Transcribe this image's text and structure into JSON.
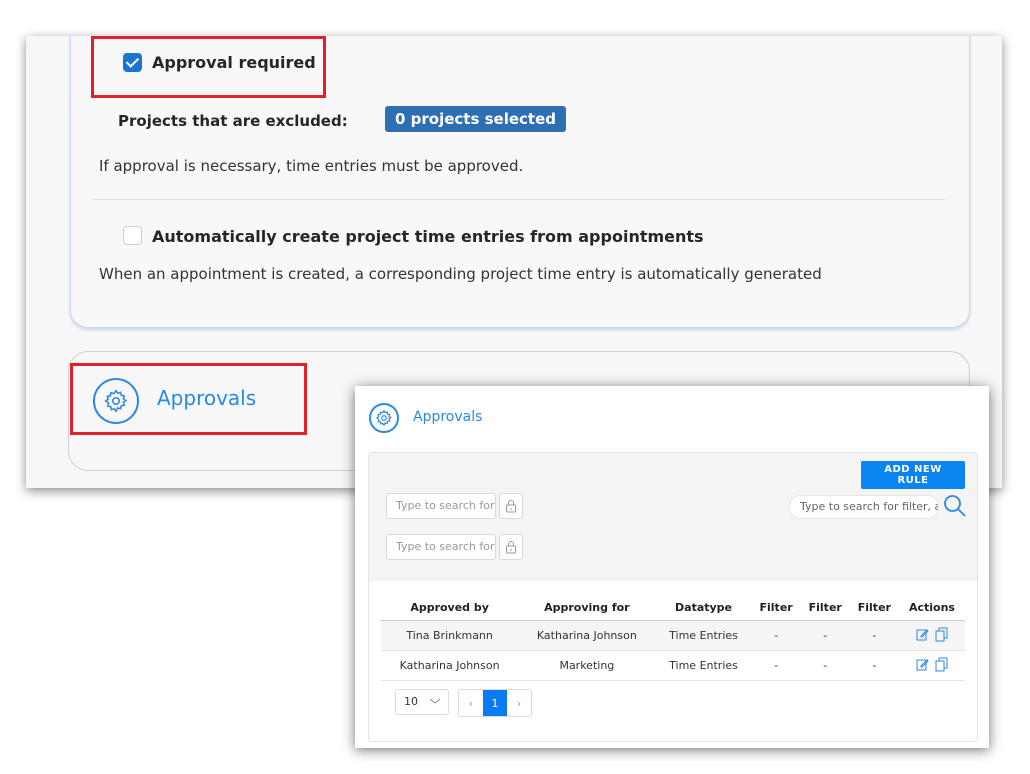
{
  "settings": {
    "approval_required_label": "Approval required",
    "approval_required_checked": true,
    "excluded_projects_label": "Projects that are excluded:",
    "excluded_projects_badge": "0 projects selected",
    "approval_help": "If approval is necessary, time entries must be approved.",
    "auto_create_label": "Automatically create project time entries from appointments",
    "auto_create_checked": false,
    "auto_create_help": "When an appointment is created, a corresponding project time entry is automatically generated"
  },
  "approvals_section": {
    "title": "Approvals",
    "icon": "gear-icon"
  },
  "approvals_window": {
    "title": "Approvals",
    "add_rule_label": "ADD NEW RULE",
    "filter_1_placeholder": "Type to search for",
    "filter_2_placeholder": "Type to search for",
    "search_placeholder": "Type to search for filter, ap",
    "columns": [
      "Approved by",
      "Approving for",
      "Datatype",
      "Filter",
      "Filter",
      "Filter",
      "Actions"
    ],
    "rows": [
      [
        "Tina Brinkmann",
        "Katharina Johnson",
        "Time Entries",
        "-",
        "-",
        "-"
      ],
      [
        "Katharina Johnson",
        "Marketing",
        "Time Entries",
        "-",
        "-",
        "-"
      ]
    ],
    "page_size": "10",
    "pager": {
      "prev": "‹",
      "current": "1",
      "next": "›"
    }
  },
  "colors": {
    "accent": "#0a84f0",
    "badge": "#2e6fb4",
    "checkbox": "#1b76d2",
    "highlight": "#e0202a"
  }
}
